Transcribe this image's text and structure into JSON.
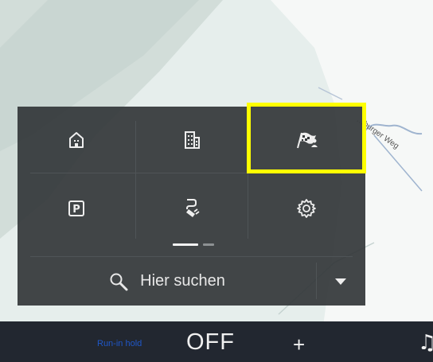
{
  "map": {
    "street_label": "…burger Weg",
    "colors": {
      "land": "#e6eeec",
      "water": "#d2ddd9",
      "road": "#9fb4cf",
      "light": "#f7f9f8"
    }
  },
  "menu": {
    "icons": [
      "home-icon",
      "office-building-icon",
      "destination-flag-icon",
      "parking-icon",
      "charging-station-icon",
      "gear-icon"
    ],
    "page_indicator": {
      "current_page": 1,
      "total_pages": 2
    },
    "search": {
      "label": "Hier suchen",
      "icon": "search-icon"
    },
    "dropdown_icon": "caret-down-icon",
    "highlight_color": "#ffff00"
  },
  "bottom_bar": {
    "mode_label": "Run-in hold",
    "value": "OFF",
    "plus_label": "+",
    "music_icon": "♫"
  }
}
